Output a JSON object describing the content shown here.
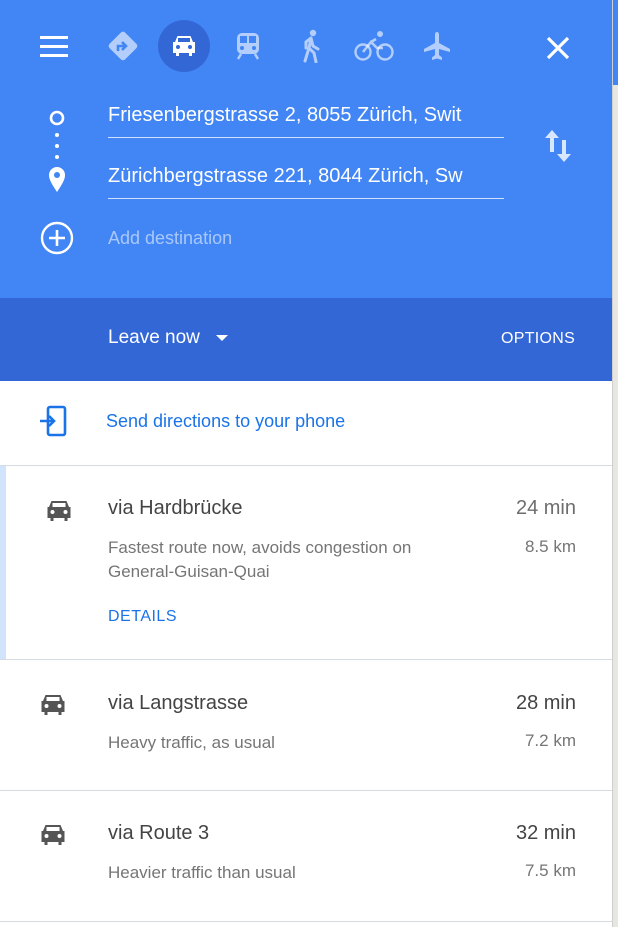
{
  "header": {
    "menu_icon": "hamburger-menu-icon",
    "modes": [
      {
        "name": "best-route-icon",
        "active": false
      },
      {
        "name": "driving-icon",
        "active": true
      },
      {
        "name": "transit-icon",
        "active": false
      },
      {
        "name": "walking-icon",
        "active": false
      },
      {
        "name": "cycling-icon",
        "active": false
      },
      {
        "name": "flight-icon",
        "active": false
      }
    ],
    "close_icon": "close-icon",
    "accent_color": "#4285f4",
    "subbar_color": "#3367d6"
  },
  "waypoints": {
    "origin": "Friesenbergstrasse 2, 8055 Zürich, Swit",
    "destination": "Zürichbergstrasse 221, 8044 Zürich, Sw",
    "add_placeholder": "Add destination",
    "swap_icon": "swap-icon"
  },
  "timing": {
    "leave_label": "Leave now",
    "options_label": "OPTIONS"
  },
  "send": {
    "label": "Send directions to your phone",
    "icon": "send-to-phone-icon"
  },
  "routes": [
    {
      "via": "via Hardbrücke",
      "time": "24 min",
      "distance": "8.5 km",
      "description": "Fastest route now, avoids congestion on General-Guisan-Quai",
      "details": "DETAILS",
      "time_color": "#6d6d6d"
    },
    {
      "via": "via Langstrasse",
      "time": "28 min",
      "distance": "7.2 km",
      "description": "Heavy traffic, as usual",
      "time_color": "#444444"
    },
    {
      "via": "via Route 3",
      "time": "32 min",
      "distance": "7.5 km",
      "description": "Heavier traffic than usual",
      "time_color": "#444444"
    }
  ]
}
